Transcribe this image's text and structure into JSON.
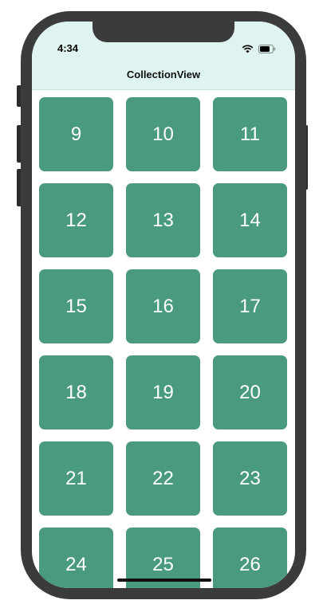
{
  "status_bar": {
    "time": "4:34"
  },
  "nav": {
    "title": "CollectionView"
  },
  "colors": {
    "cell_background": "#4a9a82",
    "navbar_background": "#dff4f0",
    "frame": "#3b3b3b"
  },
  "collection": {
    "cells": [
      "9",
      "10",
      "11",
      "12",
      "13",
      "14",
      "15",
      "16",
      "17",
      "18",
      "19",
      "20",
      "21",
      "22",
      "23",
      "24",
      "25",
      "26"
    ]
  }
}
